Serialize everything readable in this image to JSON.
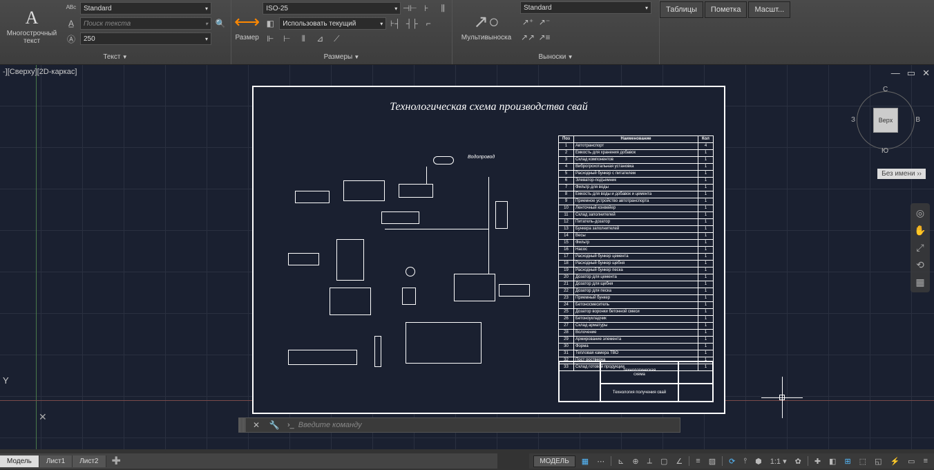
{
  "ribbon": {
    "text_panel": {
      "label": "Текст",
      "mtext_btn": "Многострочный\nтекст",
      "style_combo": "Standard",
      "find_placeholder": "Поиск текста",
      "height_combo": "250"
    },
    "dim_panel": {
      "label": "Размеры",
      "dim_btn": "Размер",
      "style_combo": "ISO-25",
      "layer_combo": "Использовать текущий"
    },
    "leader_panel": {
      "label": "Выноски",
      "mleader_btn": "Мультивыноска",
      "style_combo": "Standard"
    },
    "right_tabs": [
      "Таблицы",
      "Пометка",
      "Масшт..."
    ]
  },
  "canvas": {
    "view_label": "-][Сверху][2D-каркас]",
    "drawing_title": "Технологическая схема производства свай",
    "water_label": "Водопровод",
    "title_block_main": "Технологическая\nсхема",
    "title_block_sub": "Технология получения свай",
    "viewcube_face": "Верх",
    "viewcube": {
      "n": "С",
      "s": "Ю",
      "e": "В",
      "w": "З"
    },
    "file_tag": "Без имени ››",
    "y_label": "Y",
    "close_x": "✕"
  },
  "parts": [
    {
      "pos": "Поз",
      "name": "Наименование",
      "qty": "Кол"
    },
    {
      "pos": "1",
      "name": "Автотранспорт",
      "qty": "4"
    },
    {
      "pos": "2",
      "name": "Емкость для хранения добавок",
      "qty": "1"
    },
    {
      "pos": "3",
      "name": "Склад компонентов",
      "qty": "1"
    },
    {
      "pos": "4",
      "name": "Виброгрохотальная установка",
      "qty": "1"
    },
    {
      "pos": "5",
      "name": "Расходный бункер с питателем",
      "qty": "1"
    },
    {
      "pos": "6",
      "name": "Элеватор-подъемник",
      "qty": "1"
    },
    {
      "pos": "7",
      "name": "Фильтр для воды",
      "qty": "1"
    },
    {
      "pos": "8",
      "name": "Емкость для воды и добавок и цемента",
      "qty": "1"
    },
    {
      "pos": "9",
      "name": "Приемное устройство автотранспорта",
      "qty": "1"
    },
    {
      "pos": "10",
      "name": "Ленточный конвейер",
      "qty": "1"
    },
    {
      "pos": "11",
      "name": "Склад заполнителей",
      "qty": "1"
    },
    {
      "pos": "12",
      "name": "Питатель-дозатор",
      "qty": "1"
    },
    {
      "pos": "13",
      "name": "Бункера заполнителей",
      "qty": "1"
    },
    {
      "pos": "14",
      "name": "Весы",
      "qty": "1"
    },
    {
      "pos": "15",
      "name": "Фильтр",
      "qty": "1"
    },
    {
      "pos": "16",
      "name": "Насос",
      "qty": "1"
    },
    {
      "pos": "17",
      "name": "Расходный бункер цемента",
      "qty": "1"
    },
    {
      "pos": "18",
      "name": "Расходный бункер щебня",
      "qty": "1"
    },
    {
      "pos": "19",
      "name": "Расходный бункер песка",
      "qty": "1"
    },
    {
      "pos": "20",
      "name": "Дозатор для цемента",
      "qty": "1"
    },
    {
      "pos": "21",
      "name": "Дозатор для щебня",
      "qty": "1"
    },
    {
      "pos": "22",
      "name": "Дозатор для песка",
      "qty": "1"
    },
    {
      "pos": "23",
      "name": "Приемный бункер",
      "qty": "1"
    },
    {
      "pos": "24",
      "name": "Бетоносмеситель",
      "qty": "1"
    },
    {
      "pos": "25",
      "name": "Дозатор воронки бетонной смеси",
      "qty": "1"
    },
    {
      "pos": "26",
      "name": "Бетоноукладчик",
      "qty": "1"
    },
    {
      "pos": "27",
      "name": "Склад арматуры",
      "qty": "1"
    },
    {
      "pos": "28",
      "name": "Волочение",
      "qty": "1"
    },
    {
      "pos": "29",
      "name": "Армирование элемента",
      "qty": "1"
    },
    {
      "pos": "30",
      "name": "Форма",
      "qty": "1"
    },
    {
      "pos": "31",
      "name": "Тепловая камера ТВО",
      "qty": "1"
    },
    {
      "pos": "32",
      "name": "Пост ростверка",
      "qty": "1"
    },
    {
      "pos": "33",
      "name": "Склад готовой продукции",
      "qty": "1"
    }
  ],
  "cmdline": {
    "prompt": "›_",
    "placeholder": "Введите команду"
  },
  "tabs": {
    "items": [
      "Модель",
      "Лист1",
      "Лист2"
    ],
    "active": 0
  },
  "status": {
    "model_btn": "МОДЕЛЬ",
    "scale": "1:1"
  }
}
